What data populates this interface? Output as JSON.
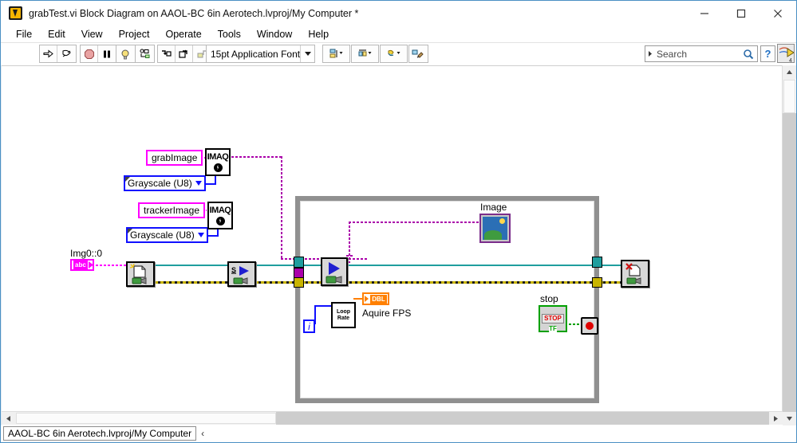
{
  "window": {
    "title": "grabTest.vi Block Diagram on AAOL-BC 6in Aerotech.lvproj/My Computer *",
    "app_icon": "labview-vi-icon",
    "minimize": "–",
    "maximize": "□",
    "close": "✕"
  },
  "menu": {
    "items": [
      {
        "label": "File"
      },
      {
        "label": "Edit"
      },
      {
        "label": "View"
      },
      {
        "label": "Project"
      },
      {
        "label": "Operate"
      },
      {
        "label": "Tools"
      },
      {
        "label": "Window"
      },
      {
        "label": "Help"
      }
    ]
  },
  "toolbar": {
    "run_icon": "run-arrow-icon",
    "run_continuous_icon": "run-continuously-icon",
    "abort_icon": "abort-execution-icon",
    "pause_icon": "pause-icon",
    "highlight_icon": "highlight-execution-bulb-icon",
    "retain_values_icon": "retain-wire-values-icon",
    "step_into_icon": "step-into-icon",
    "step_over_icon": "step-over-icon",
    "step_out_icon": "step-out-icon",
    "font_label": "15pt Application Font",
    "align_icon": "align-objects-icon",
    "distribute_icon": "distribute-objects-icon",
    "resize_icon": "resize-objects-icon",
    "cleanup_icon": "clean-up-diagram-icon",
    "search_placeholder": "Search",
    "search_value": "",
    "search_icon": "magnifier-icon",
    "help_label": "?",
    "context_help_icon": "context-help-icon"
  },
  "diagram": {
    "grab_image_constant": "grabImage",
    "tracker_image_constant": "trackerImage",
    "grayscale_enum_1": "Grayscale (U8)",
    "grayscale_enum_2": "Grayscale (U8)",
    "imaq_create_1": "IMAQ",
    "imaq_create_2": "IMAQ",
    "camera_name_label": "Img0::0",
    "camera_name_value": "abc",
    "open_camera_icon": "imaqdx-open-camera-icon",
    "configure_grab_icon": "imaqdx-configure-grab-icon",
    "grab_icon": "imaqdx-grab-icon",
    "close_camera_icon": "imaqdx-close-camera-icon",
    "image_indicator_label": "Image",
    "image_indicator_icon": "image-display-icon",
    "loop_rate_label": "Loop\nRate",
    "loop_rate_line1": "Loop",
    "loop_rate_line2": "Rate",
    "iteration_terminal": "i",
    "fps_indicator_label": "Aquire FPS",
    "fps_indicator_type": "DBL",
    "stop_label": "stop",
    "stop_glyph": "STOP",
    "stop_bool_type": "TF",
    "loop_stop_terminal": "stop-condition-terminal"
  },
  "colors": {
    "string_wire": "#ff00ff",
    "imaq_session_wire": "#1f9e9e",
    "error_wire": "#b8a400",
    "numeric_wire": "#1010ff",
    "dbl_wire": "#ff8000",
    "boolean_wire": "#00a000",
    "loop_border": "#909090"
  },
  "scroll": {
    "v_up": "▲",
    "v_down": "▼",
    "h_left": "◀",
    "h_right": "▶"
  },
  "status": {
    "project_path": "AAOL-BC 6in Aerotech.lvproj/My Computer",
    "chevron": "‹"
  }
}
